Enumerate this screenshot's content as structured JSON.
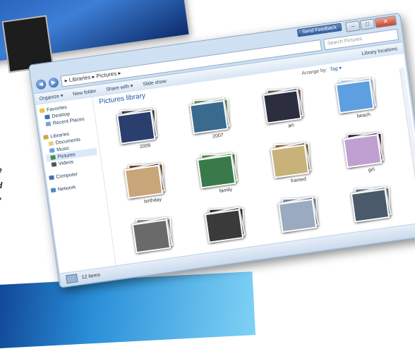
{
  "window": {
    "address_path": "▸ Libraries ▸ Pictures ▸",
    "search_placeholder": "Search Pictures",
    "slideshow_button": "Send Feedback",
    "caption": {
      "min": "–",
      "max": "□",
      "close": "✕"
    }
  },
  "toolbar": {
    "organize": "Organize ▾",
    "new_folder": "New folder",
    "share_with": "Share with ▾",
    "slide_show": "Slide show",
    "library_locations": "Library locations"
  },
  "sidebar": {
    "favorites": {
      "label": "Favorites",
      "items": [
        {
          "label": "Desktop",
          "color": "#3a6fc0"
        },
        {
          "label": "Recent Places",
          "color": "#7aa5d8"
        }
      ]
    },
    "libraries": {
      "label": "Libraries",
      "items": [
        {
          "label": "Documents",
          "color": "#e6d27a"
        },
        {
          "label": "Music",
          "color": "#6a9be0"
        },
        {
          "label": "Pictures",
          "color": "#3e8f4a"
        },
        {
          "label": "Videos",
          "color": "#555"
        }
      ]
    },
    "computer": "Computer",
    "network": "Network"
  },
  "main": {
    "library_title": "Pictures library",
    "arrange_by_label": "Arrange by:",
    "arrange_by_value": "Tag ▾",
    "stacks": [
      {
        "label": "2006",
        "colors": [
          "#3b3f46",
          "#56627a",
          "#2b3f6e"
        ]
      },
      {
        "label": "2007",
        "colors": [
          "#6e8f5a",
          "#9db3c9",
          "#3a6a8e"
        ]
      },
      {
        "label": "art",
        "colors": [
          "#7a5a4a",
          "#4a5a8a",
          "#2d2d40"
        ]
      },
      {
        "label": "beach",
        "colors": [
          "#bcd9f5",
          "#9cc6ef",
          "#5e9fe0"
        ]
      },
      {
        "label": "birthday",
        "colors": [
          "#6b4a2a",
          "#3a2a1a",
          "#c9a57a"
        ]
      },
      {
        "label": "family",
        "colors": [
          "#4e8a3a",
          "#7ac05a",
          "#3a7a4a"
        ]
      },
      {
        "label": "framed",
        "colors": [
          "#8a7040",
          "#5a4a2a",
          "#c9b27a"
        ]
      },
      {
        "label": "girl",
        "colors": [
          "#2a1a3a",
          "#5a3a6a",
          "#c0a0d0"
        ]
      },
      {
        "label": "",
        "colors": [
          "#8a8a80",
          "#a0a0a0",
          "#6a6a6a"
        ]
      },
      {
        "label": "",
        "colors": [
          "#2a2a2a",
          "#505a6a",
          "#3a3a3a"
        ]
      },
      {
        "label": "",
        "colors": [
          "#7a8aa0",
          "#5a6a80",
          "#9aaac0"
        ]
      },
      {
        "label": "",
        "colors": [
          "#6a7a8a",
          "#8a9aaa",
          "#4a5a6a"
        ]
      }
    ]
  },
  "status": {
    "items_text": "12 items"
  },
  "decor": {
    "quote_fragment": "e\nd\n\""
  }
}
